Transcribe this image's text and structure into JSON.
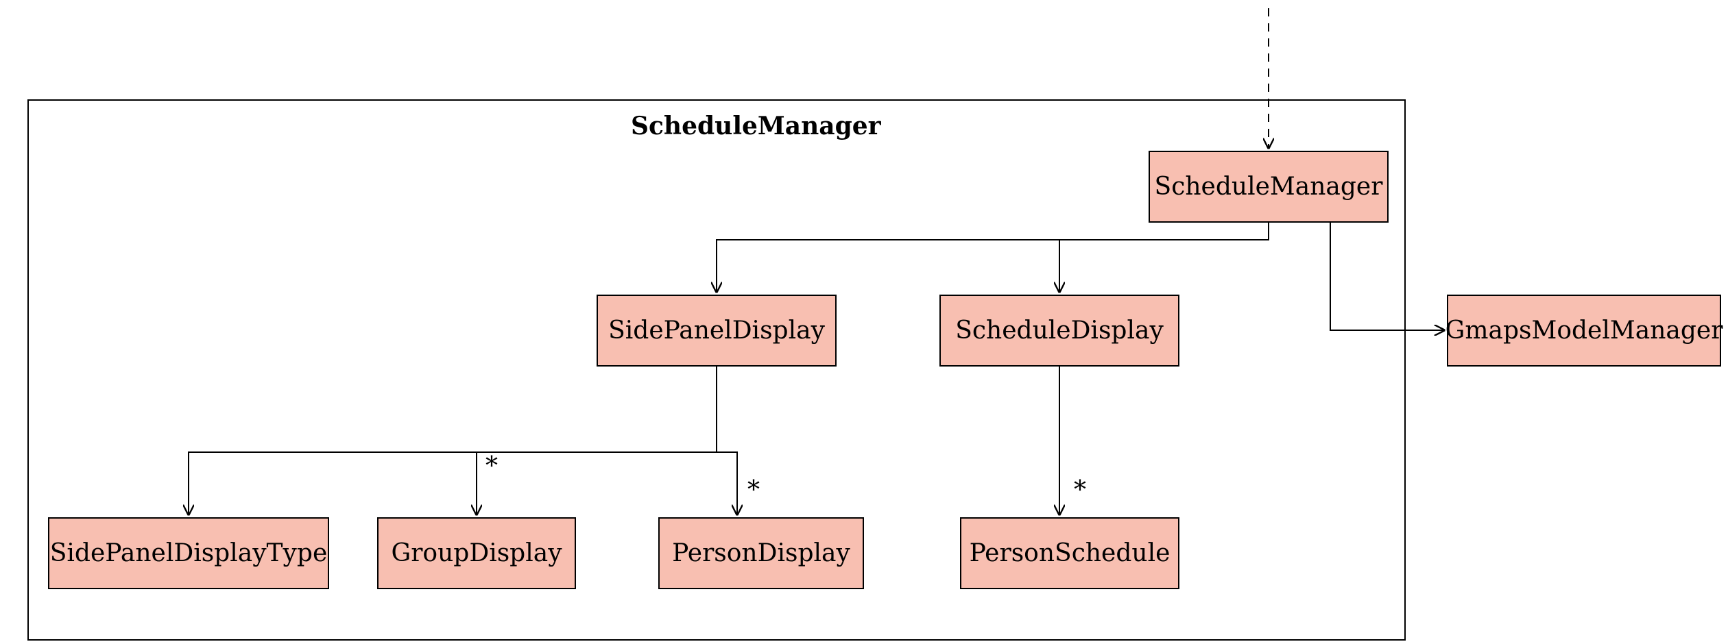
{
  "diagram": {
    "outer_title": "ScheduleManager",
    "nodes": {
      "schedule_manager": "ScheduleManager",
      "side_panel_display": "SidePanelDisplay",
      "schedule_display": "ScheduleDisplay",
      "gmaps_model_manager": "GmapsModelManager",
      "side_panel_display_type": "SidePanelDisplayType",
      "group_display": "GroupDisplay",
      "person_display": "PersonDisplay",
      "person_schedule": "PersonSchedule"
    },
    "multiplicities": {
      "group_display": "*",
      "person_display": "*",
      "person_schedule": "*"
    }
  }
}
